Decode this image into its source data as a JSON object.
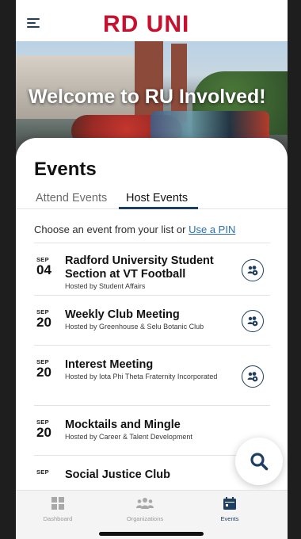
{
  "header": {
    "brand_text": "RD UNI"
  },
  "hero": {
    "title": "Welcome to RU Involved!"
  },
  "sheet": {
    "title": "Events"
  },
  "tabs": [
    {
      "label": "Attend Events",
      "active": false
    },
    {
      "label": "Host Events",
      "active": true
    }
  ],
  "choose": {
    "prefix": "Choose an event from your list or ",
    "link": "Use a PIN"
  },
  "events": [
    {
      "month": "SEP",
      "day": "04",
      "title": "Radford University Student Section at VT Football",
      "host": "Hosted by Student Affairs",
      "has_action": true
    },
    {
      "month": "SEP",
      "day": "20",
      "title": "Weekly Club Meeting",
      "host": "Hosted by Greenhouse & Selu Botanic Club",
      "has_action": true
    },
    {
      "month": "SEP",
      "day": "20",
      "title": "Interest Meeting",
      "host": "Hosted by Iota Phi Theta Fraternity Incorporated",
      "has_action": true
    },
    {
      "month": "SEP",
      "day": "20",
      "title": "Mocktails and Mingle",
      "host": "Hosted by Career & Talent Development",
      "has_action": false
    },
    {
      "month": "SEP",
      "day": "",
      "title": "Social Justice Club",
      "host": "",
      "has_action": false
    }
  ],
  "fab": {
    "icon": "search-icon"
  },
  "bottom_nav": [
    {
      "label": "Dashboard",
      "icon": "dashboard-icon"
    },
    {
      "label": "Organizations",
      "icon": "organizations-icon"
    },
    {
      "label": "Events",
      "icon": "calendar-icon",
      "active": true
    }
  ],
  "colors": {
    "accent": "#1f3e63",
    "brand_red": "#c8102e",
    "link": "#2a6fb5"
  }
}
